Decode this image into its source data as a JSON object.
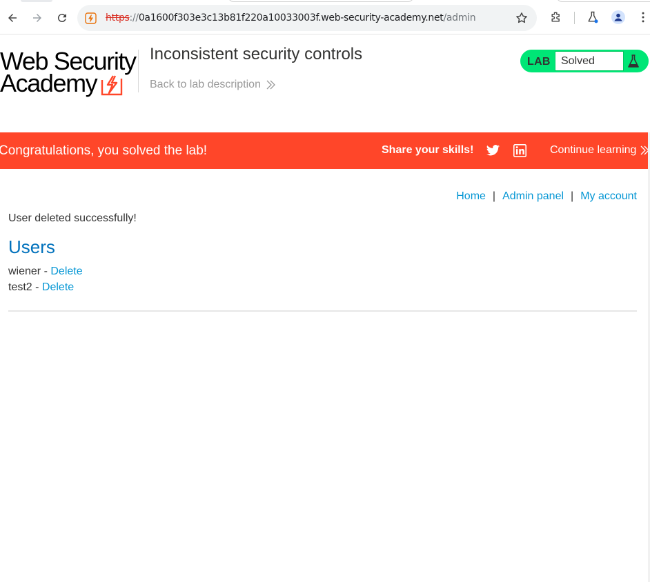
{
  "browser": {
    "url_scheme": "https",
    "url_separator": "://",
    "url_host": "0a1600f303e3c13b81f220a10033003f.web-security-academy.net",
    "url_path": "/admin"
  },
  "header": {
    "logo_line1": "Web Security",
    "logo_line2": "Academy",
    "lab_title": "Inconsistent security controls",
    "back_link": "Back to lab description",
    "lab_badge": "LAB",
    "lab_status": "Solved"
  },
  "banner": {
    "congrats": "Congratulations, you solved the lab!",
    "share": "Share your skills!",
    "continue": "Continue learning"
  },
  "nav": {
    "home": "Home",
    "pipe1": "|",
    "admin": "Admin panel",
    "pipe2": "|",
    "account": "My account"
  },
  "main": {
    "message": "User deleted successfully!",
    "heading": "Users",
    "users": [
      {
        "name": "wiener",
        "separator": "-",
        "action": "Delete"
      },
      {
        "name": "test2",
        "separator": "-",
        "action": "Delete"
      }
    ]
  },
  "colors": {
    "banner": "#ff4629",
    "lab_green": "#00e676",
    "link": "#0496d4",
    "heading": "#0071bc"
  }
}
